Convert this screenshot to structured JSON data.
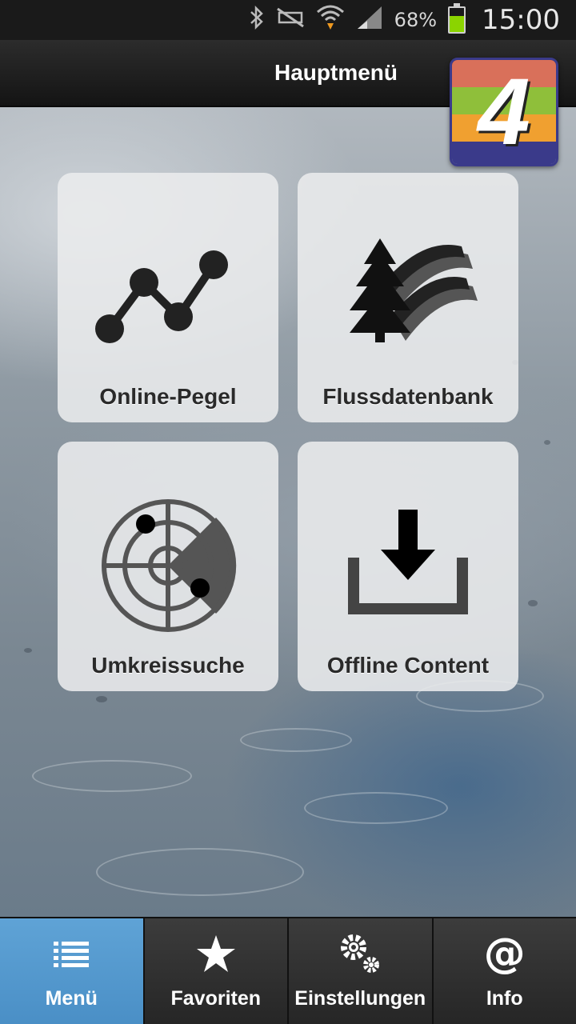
{
  "status_bar": {
    "battery_percent": "68%",
    "battery_level": 0.68,
    "time": "15:00",
    "icons": [
      "bluetooth-icon",
      "mute-icon",
      "wifi-icon",
      "signal-icon",
      "battery-icon"
    ]
  },
  "header": {
    "title": "Hauptmenü",
    "logo_text": "4",
    "logo_colors": [
      "#d9705a",
      "#8fbf3a",
      "#f0a030",
      "#3a3a8a"
    ]
  },
  "tiles": [
    {
      "label": "Online-Pegel",
      "icon": "line-chart-icon"
    },
    {
      "label": "Flussdatenbank",
      "icon": "tree-river-icon"
    },
    {
      "label": "Umkreissuche",
      "icon": "radar-icon"
    },
    {
      "label": "Offline Content",
      "icon": "download-icon"
    }
  ],
  "tabbar": {
    "active_color": "#5a9fd4",
    "items": [
      {
        "label": "Menü",
        "icon": "list-icon",
        "active": true
      },
      {
        "label": "Favoriten",
        "icon": "star-icon",
        "active": false
      },
      {
        "label": "Einstellungen",
        "icon": "gears-icon",
        "active": false
      },
      {
        "label": "Info",
        "icon": "at-icon",
        "active": false
      }
    ]
  }
}
